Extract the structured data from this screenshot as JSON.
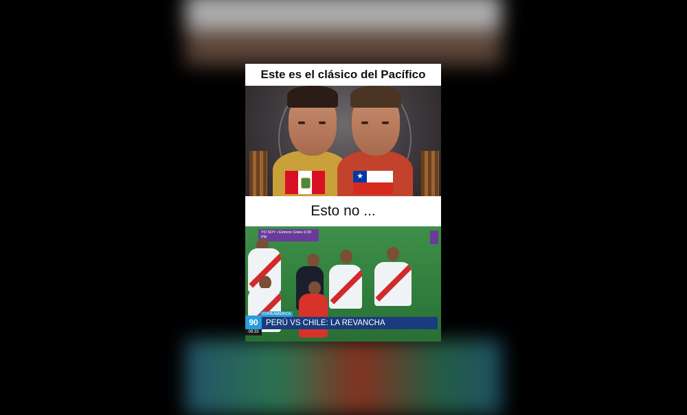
{
  "top_caption": "Este es el clásico del Pacífico",
  "middle_caption": "Esto no ...",
  "flags": [
    "peru-flag",
    "chile-flag"
  ],
  "broadcast": {
    "program_badge": "YO SOY • Estreno Goles 9:30 PM",
    "section_tag": "COPA AMÉRICA",
    "headline": "PERÚ VS CHILE: LA REVANCHA",
    "channel_logo": "90",
    "clock": "08:33"
  },
  "colors": {
    "peru_red": "#d91023",
    "chile_blue": "#0039a6",
    "chile_red": "#d52b1e",
    "ticker_blue": "#1a3b7e"
  }
}
